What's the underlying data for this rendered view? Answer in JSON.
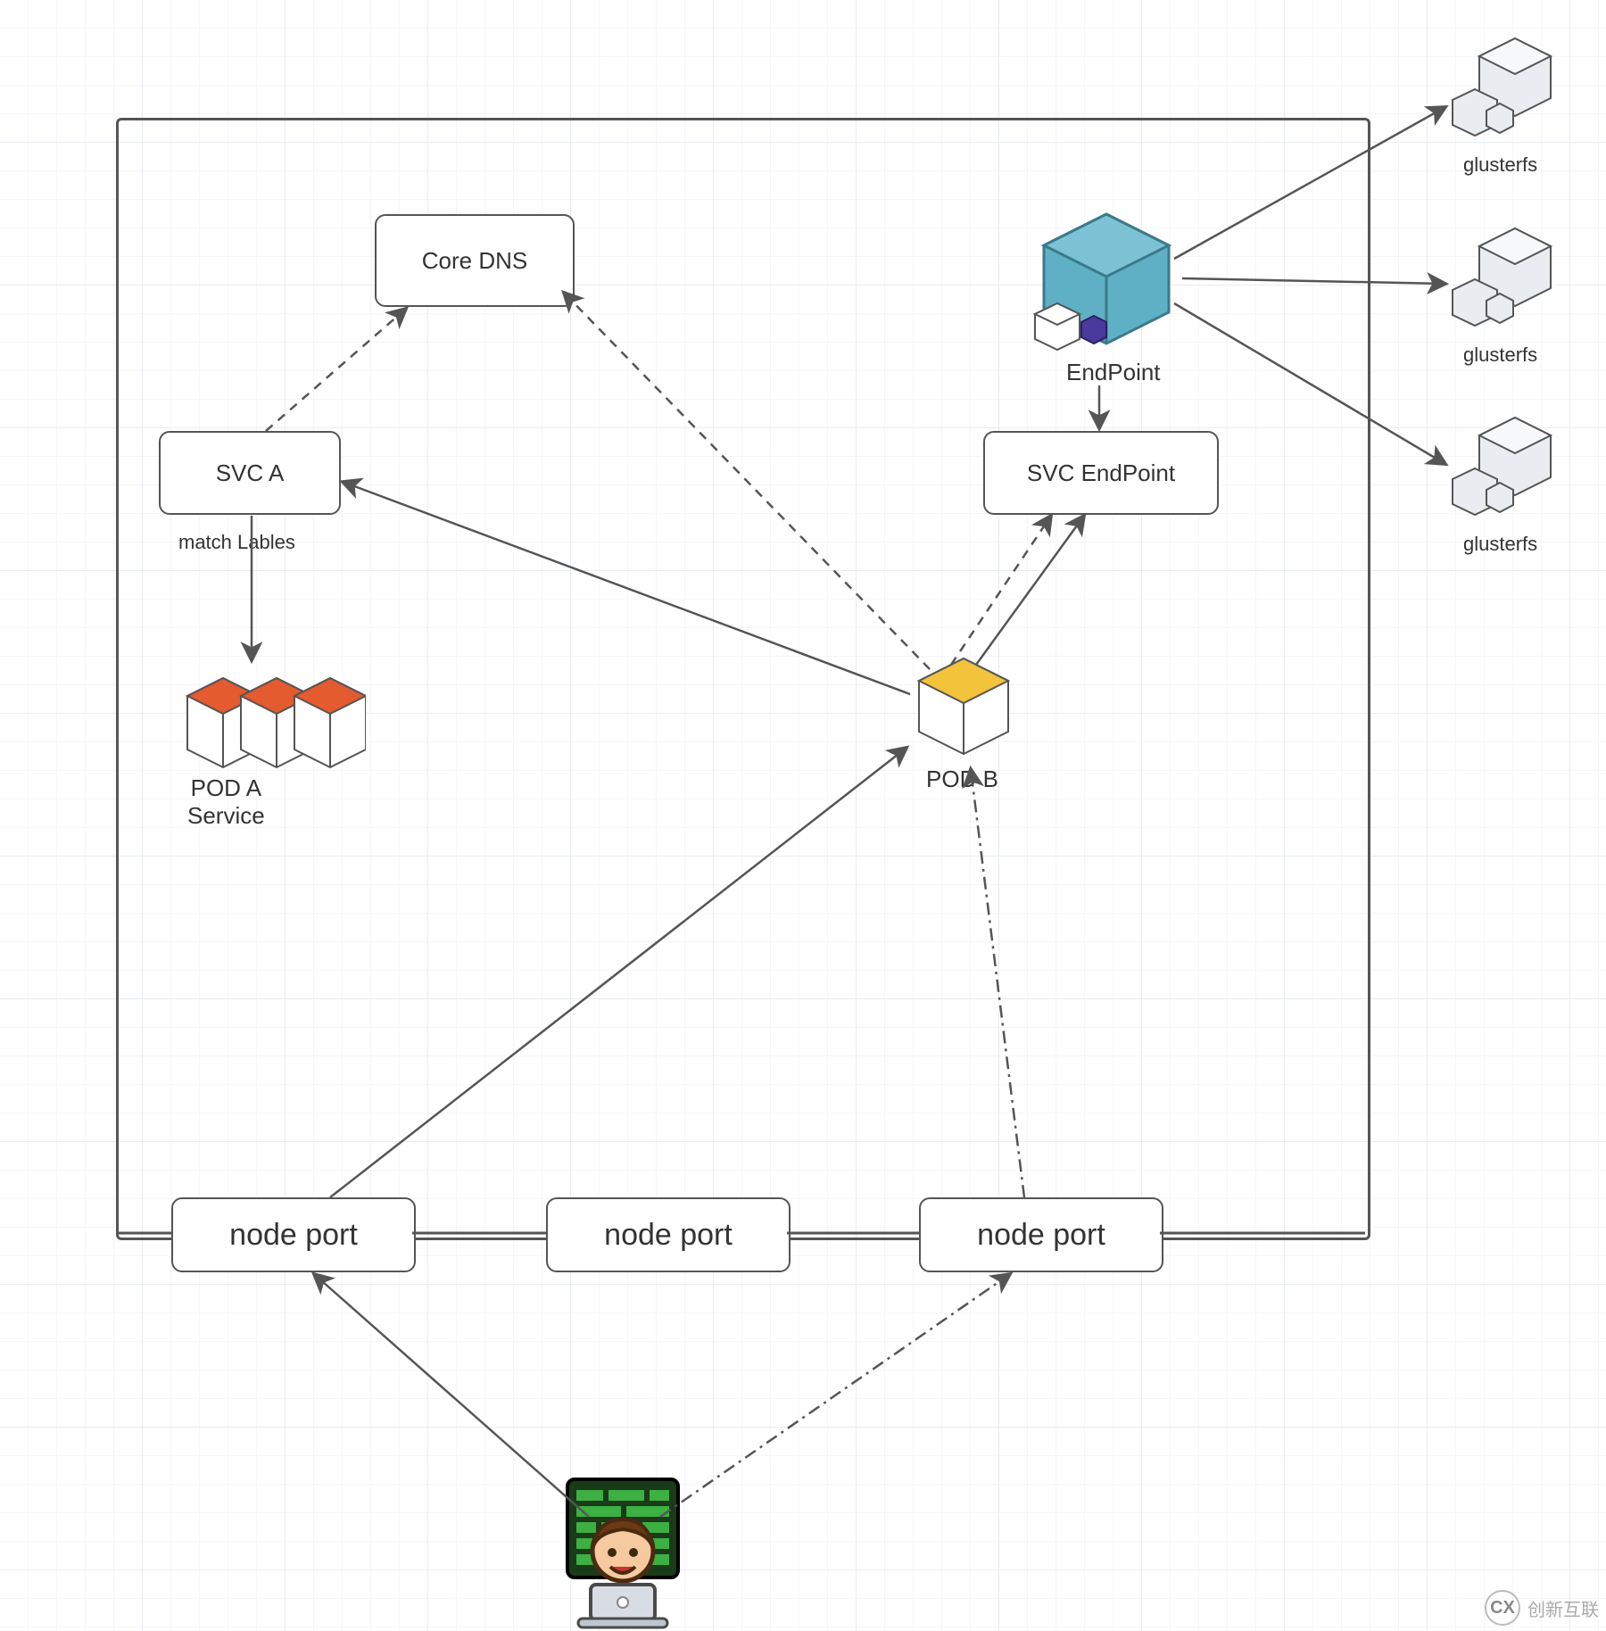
{
  "diagram": {
    "type": "architecture",
    "container_label": "",
    "nodes": {
      "core_dns": {
        "label": "Core DNS"
      },
      "svc_a": {
        "label": "SVC A"
      },
      "match_labels": {
        "label": "match Lables"
      },
      "pod_a_service": {
        "label": "POD A\nService"
      },
      "endpoint": {
        "label": "EndPoint"
      },
      "svc_endpoint": {
        "label": "SVC EndPoint"
      },
      "pod_b": {
        "label": "POD B"
      },
      "node_port_1": {
        "label": "node port"
      },
      "node_port_2": {
        "label": "node port"
      },
      "node_port_3": {
        "label": "node port"
      },
      "glusterfs_1": {
        "label": "glusterfs"
      },
      "glusterfs_2": {
        "label": "glusterfs"
      },
      "glusterfs_3": {
        "label": "glusterfs"
      },
      "user": {
        "label": ""
      }
    },
    "edges": [
      {
        "from": "svc_a",
        "to": "core_dns",
        "style": "dashed",
        "dir": "forward"
      },
      {
        "from": "pod_b",
        "to": "core_dns",
        "style": "dashed",
        "dir": "forward"
      },
      {
        "from": "pod_b",
        "to": "svc_endpoint",
        "style": "dashed",
        "dir": "forward"
      },
      {
        "from": "pod_b",
        "to": "svc_a",
        "style": "solid",
        "dir": "forward"
      },
      {
        "from": "pod_b",
        "to": "svc_endpoint",
        "style": "solid",
        "dir": "forward"
      },
      {
        "from": "svc_a",
        "to": "pod_a_service",
        "style": "solid",
        "dir": "forward",
        "label": "match Lables"
      },
      {
        "from": "endpoint",
        "to": "svc_endpoint",
        "style": "solid",
        "dir": "forward"
      },
      {
        "from": "endpoint",
        "to": "glusterfs_1",
        "style": "solid",
        "dir": "forward"
      },
      {
        "from": "endpoint",
        "to": "glusterfs_2",
        "style": "solid",
        "dir": "forward"
      },
      {
        "from": "endpoint",
        "to": "glusterfs_3",
        "style": "solid",
        "dir": "forward"
      },
      {
        "from": "node_port_1",
        "to": "pod_b",
        "style": "solid",
        "dir": "forward"
      },
      {
        "from": "node_port_3",
        "to": "pod_b",
        "style": "dashdot",
        "dir": "forward"
      },
      {
        "from": "user",
        "to": "node_port_1",
        "style": "solid",
        "dir": "forward"
      },
      {
        "from": "user",
        "to": "node_port_3",
        "style": "dashdot",
        "dir": "forward"
      }
    ],
    "colors": {
      "line": "#555555",
      "endpoint_cube": "#5fb0c4",
      "endpoint_small": "#4a3a9e",
      "pod_a_cube": "#e35b2e",
      "pod_b_cube": "#f2c33b",
      "user_screen": "#2e8b2e",
      "glusterfs_cube": "#d7dde3"
    }
  },
  "watermark": {
    "text": "创新互联",
    "badge": "CX"
  }
}
